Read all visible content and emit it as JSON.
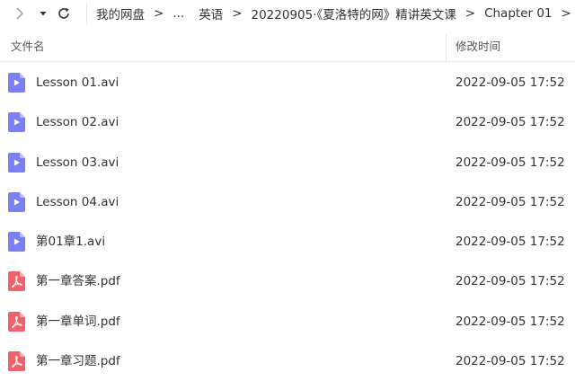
{
  "breadcrumb": {
    "items": [
      "我的网盘",
      "...",
      "英语",
      "20220905·《夏洛特的网》精讲英文课",
      "Chapter 01"
    ],
    "separator": ">"
  },
  "columns": {
    "name": "文件名",
    "modified": "修改时间"
  },
  "files": [
    {
      "name": "Lesson 01.avi",
      "modified": "2022-09-05 17:52",
      "icon": "video-file-icon"
    },
    {
      "name": "Lesson 02.avi",
      "modified": "2022-09-05 17:52",
      "icon": "video-file-icon"
    },
    {
      "name": "Lesson 03.avi",
      "modified": "2022-09-05 17:52",
      "icon": "video-file-icon"
    },
    {
      "name": "Lesson 04.avi",
      "modified": "2022-09-05 17:52",
      "icon": "video-file-icon"
    },
    {
      "name": "第01章1.avi",
      "modified": "2022-09-05 17:52",
      "icon": "video-file-icon"
    },
    {
      "name": "第一章答案.pdf",
      "modified": "2022-09-05 17:52",
      "icon": "pdf-file-icon"
    },
    {
      "name": "第一章单词.pdf",
      "modified": "2022-09-05 17:52",
      "icon": "pdf-file-icon"
    },
    {
      "name": "第一章习题.pdf",
      "modified": "2022-09-05 17:52",
      "icon": "pdf-file-icon"
    }
  ],
  "colors": {
    "video_icon": "#7b7ff5",
    "pdf_icon": "#f2616b"
  }
}
